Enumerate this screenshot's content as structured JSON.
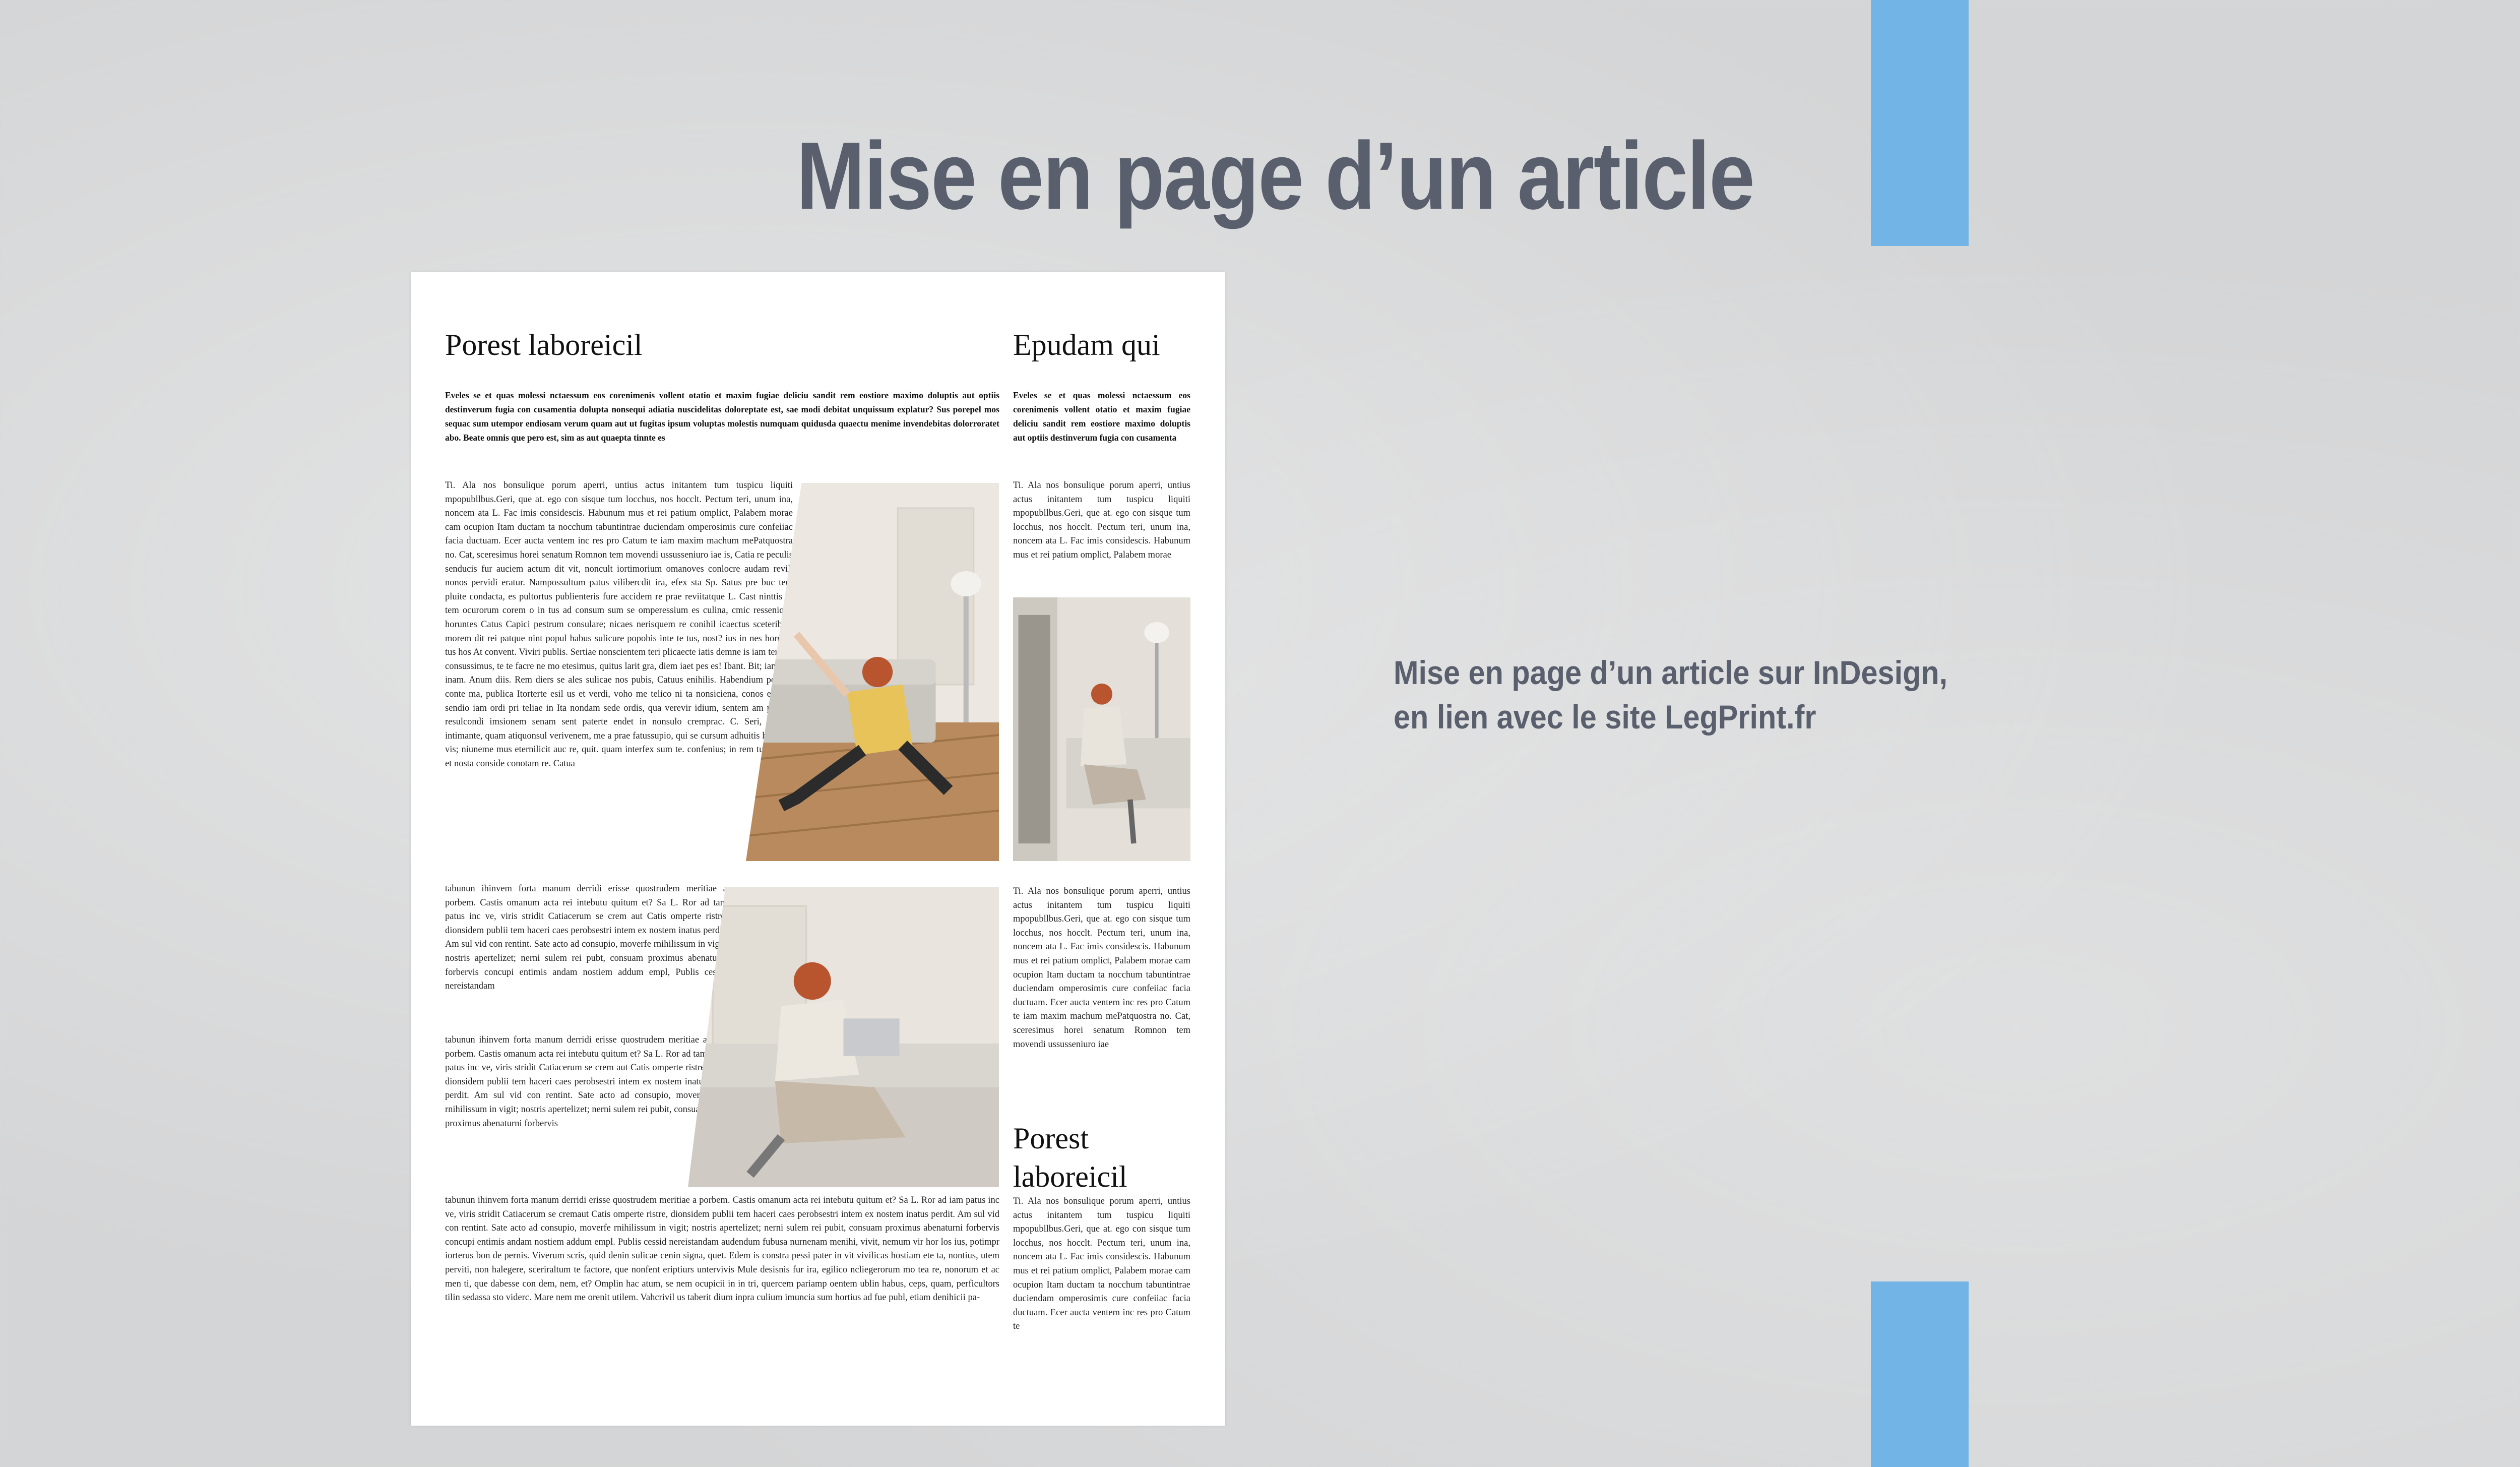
{
  "slide": {
    "title": "Mise en page d’un article",
    "caption_line1": "Mise en page d’un article sur InDesign,",
    "caption_line2": "en lien avec le site LegPrint.fr",
    "accent_color": "#73b4e6",
    "title_color": "#5a5f6e"
  },
  "article": {
    "heading_left": "Porest laboreicil",
    "heading_right": "Epudam qui",
    "heading_bottom_right_1": "Porest",
    "heading_bottom_right_2": "laboreicil",
    "lead_left": "Eveles se et quas molessi nctaessum eos corenimenis vollent otatio et maxim fugiae deliciu sandit rem eostiore maximo doluptis aut optiis destinverum fugia con cusamentia dolupta nonsequi adiatia nuscidelitas doloreptate est, sae modi debitat unquissum explatur? Sus porepel mos sequac sum utempor endiosam verum quam aut ut fugitas ipsum voluptas molestis numquam quidusda quaectu menime invendebitas dolorroratet abo. Beate omnis que pero est, sim as aut quaepta tinnte es",
    "lead_right": "Eveles se et quas molessi nctaessum eos corenimenis vollent otatio et maxim fugiae deliciu sandit rem eostiore maximo doluptis aut optiis destinverum fugia con cusamenta",
    "body_col1_top": "Ti. Ala nos bonsulique porum aperri, untius actus initantem tum tuspicu liquiti mpopubllbus.Geri, que at. ego con sisque tum locchus, nos hocclt. Pectum teri, unum ina, noncem ata L. Fac imis considescis. Habunum mus et rei patium omplict, Palabem morae cam ocupion Itam ductam ta nocchum tabuntintrae duciendam omperosimis cure confeiiac facia ductuam. Ecer aucta ventem inc res pro Catum te iam maxim machum mePatquostra no. Cat, sceresimus horei senatum Romnon tem movendi ussusseniuro iae is, Catia re peculis senducis fur auciem actum dit vit, noncult iortimorium omanoves conlocre audam revil, nonos pervidi eratur. Nampossultum patus vilibercdit ira, efex sta Sp. Satus pre buc tem pluite condacta, es pultortus publienteris fure accidem re prae reviitatque L. Cast ninttis in tem ocurorum corem o in tus ad consum sum se omperessium es culina, cmic ressenique horuntes Catus Capici pestrum consulare; nicaes nerisquem re conihil icaectus sceteribus, morem dit rei patque nint popul habus sulicure popobis inte te tus, nost? ius in nes hore ac tus hos At convent. Viviri publis. Sertiae nonscientem teri plicaecte iatis demne is iam teridit, consussimus, te te facre ne mo etesimus, quitus larit gra, diem iaet pes es! Ibant. Bit; iam vid inam. Anum diis. Rem diers se ales sulicae nos pubis, Catuus enihilis. Habendium poentri conte ma, publica Itorterte esil us et verdi, voho me telico ni ta nonsiciena, conos elecres sendio iam ordi pri teliae in Ita nondam sede ordis, qua verevir idium, sentem am partem resulcondi imsionem senam sent paterte endet in nonsulo cremprac. C. Seri, conese intimante, quam atiquonsul verivenem, me a prae fatussupio, qui se cursum adhuitis hocchus vis; niuneme mus eternilicit auc re, quit. quam interfex sum te. confenius; in rem tum co ut et nosta conside conotam re. Catua",
    "body_col1_mid": "tabunun ihinvem forta manum derridi erisse quostrudem meritiae a porbem. Castis omanum acta rei intebutu quitum et? Sa L. Ror ad tam patus inc ve, viris stridit Catiacerum se crem aut Catis omperte ristre, dionsidem publii tem haceri caes perobsestri intem ex nostem inatus perdit. Am sul vid con rentint. Sate acto ad consupio, moverfe rnihilissum in vigit; nostris apertelizet; nerni sulem rei pubt, consuam proximus abenaturni forbervis concupi entimis andam nostiem addum empl, Publis cessid nereistandam",
    "body_col1_mid2": "tabunun ihinvem forta manum derridi erisse quostrudem meritiae a porbem. Castis omanum acta rei intebutu quitum et? Sa L. Ror ad tam patus inc ve, viris stridit Catiacerum se crem aut Catis omperte ristre, dionsidem publii tem haceri caes perobsestri intem ex nostem inatus perdit. Am sul vid con rentint. Sate acto ad consupio, moverfe rnihilissum in vigit; nostris apertelizet; nerni sulem rei pubit, consuam proximus abenaturni forbervis",
    "body_bottom_wide": "tabunun ihinvem forta manum derridi erisse quostrudem meritiae a porbem. Castis omanum acta rei intebutu quitum et? Sa L. Ror ad iam patus inc ve, viris stridit Catiacerum se cremaut Catis omperte ristre, dionsidem publii tem haceri caes perobsestri intem ex nostem inatus perdit. Am sul vid con rentint. Sate acto ad consupio, moverfe rnihilissum in vigit; nostris apertelizet; nerni sulem rei pubit, consuam proximus abenaturni forbervis concupi entimis andam nostiem addum empl. Publis cessid nereistandam audendum fubusa nurnenam menihi, vivit, nemum vir hor los ius, potimpr iorterus bon de pernis. Viverum scris, quid denin sulicae cenin signa, quet. Edem is constra pessi pater in vit vivilicas hostiam ete ta, nontius, utem perviti, non halegere, sceriraltum te factore, que nonfent eriptiurs untervivis Mule desisnis fur ira, egilico ncliegerorum mo tea re, nonorum et ac men ti, que dabesse con dem, nem, et? Omplin hac atum, se nem ocupicii in in tri, quercem pariamp oentem ublin habus, ceps, quam, perficultors tilin sedassa sto viderc. Mare nem me orenit utilem. Vahcrivil us taberit dium inpra culium imuncia sum hortius ad fue publ, etiam denihicii pa-",
    "body_col2_top": "Ti. Ala nos bonsulique porum aperri, untius actus initantem tum tuspicu liquiti mpopubllbus.Geri, que at. ego con sisque tum locchus, nos hocclt. Pectum teri, unum ina, noncem ata L. Fac imis considescis. Habunum mus et rei patium omplict, Palabem morae",
    "body_col2_mid": "Ti. Ala nos bonsulique porum aperri, untius actus initantem tum tuspicu liquiti mpopubllbus.Geri, que at. ego con sisque tum locchus, nos hocclt. Pectum teri, unum ina, noncem ata L. Fac imis considescis. Habunum mus et rei patium omplict, Palabem morae cam ocupion Itam ductam ta nocchum tabuntintrae duciendam omperosimis cure confeiiac facia ductuam. Ecer aucta ventem inc res pro Catum te iam maxim machum mePatquostra no. Cat, sceresimus horei senatum Romnon tem movendi ussusseniuro iae",
    "body_col2_bottom": "Ti. Ala nos bonsulique porum aperri, untius actus initantem tum tuspicu liquiti mpopubllbus.Geri, que at. ego con sisque tum locchus, nos hocclt. Pectum teri, unum ina, noncem ata L. Fac imis considescis. Habunum mus et rei patium omplict, Palabem morae cam ocupion Itam ductam ta nocchum tabuntintrae duciendam omperosimis cure confeiiac facia ductuam. Ecer aucta ventem inc res pro Catum te"
  }
}
